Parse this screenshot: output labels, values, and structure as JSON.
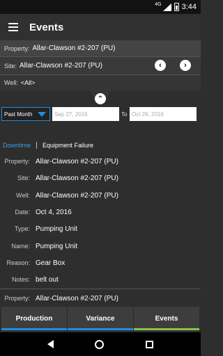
{
  "status_bar": {
    "network": "4G",
    "time": "3:44"
  },
  "app_bar": {
    "title": "Events"
  },
  "filters": {
    "property_label": "Property:",
    "property_value": "Allar-Clawson #2-207 (PU)",
    "site_label": "Site:",
    "site_value": "Allar-Clawson #2-207 (PU)",
    "well_label": "Well:",
    "well_value": "<All>",
    "period": "Past Month",
    "date_from_placeholder": "Sep 27, 2016",
    "to_label": "To",
    "date_to_placeholder": "Oct 26, 2016"
  },
  "event_types": {
    "active": "Downtime",
    "other": "Equipment Failure"
  },
  "event": {
    "rows": [
      {
        "label": "Property:",
        "value": "Allar-Clawson #2-207 (PU)"
      },
      {
        "label": "Site:",
        "value": "Allar-Clawson #2-207 (PU)"
      },
      {
        "label": "Well:",
        "value": "Allar-Clawson #2-207 (PU)"
      },
      {
        "label": "Date:",
        "value": "Oct 4, 2016"
      },
      {
        "label": "Type:",
        "value": "Pumping Unit"
      },
      {
        "label": "Name:",
        "value": "Pumping Unit"
      },
      {
        "label": "Reason:",
        "value": "Gear Box"
      },
      {
        "label": "Notes:",
        "value": "belt out"
      }
    ],
    "next_property_label": "Property:",
    "next_property_value": "Allar-Clawson #2-207 (PU)"
  },
  "bottom_tabs": [
    {
      "label": "Production",
      "indicator": "#1f8ee0"
    },
    {
      "label": "Variance",
      "indicator": "#1f8ee0"
    },
    {
      "label": "Events",
      "indicator": "#8bc34a"
    }
  ],
  "colors": {
    "accent_blue": "#1f8ee0",
    "accent_green": "#8bc34a"
  }
}
